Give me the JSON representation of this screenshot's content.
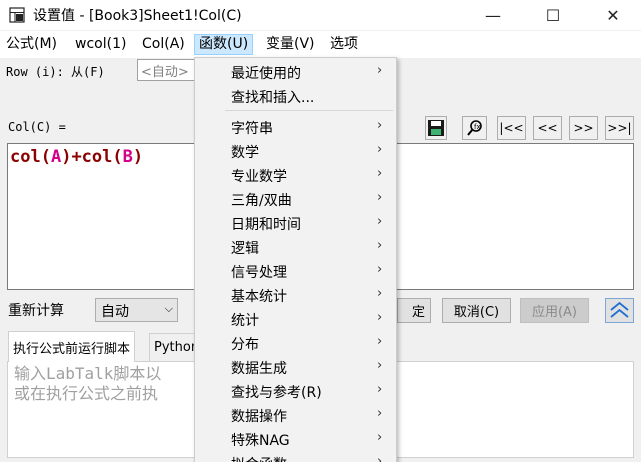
{
  "window": {
    "title": "设置值 - [Book3]Sheet1!Col(C)",
    "minimize_glyph": "—",
    "maximize_glyph": "☐",
    "close_glyph": "✕"
  },
  "menubar": {
    "items": [
      "公式(M)",
      "wcol(1)",
      "Col(A)",
      "函数(U)",
      "变量(V)",
      "选项"
    ],
    "active_index": 3
  },
  "row_range": {
    "label": "Row (i): 从(F)",
    "from_value": "<自动>"
  },
  "column": {
    "label": "Col(C) ="
  },
  "toolbar": {
    "save_icon": "save-icon",
    "find_icon": "find-icon",
    "first_label": "|<<",
    "prev_label": "<<",
    "next_label": ">>",
    "last_label": ">>|"
  },
  "formula": {
    "func1": "col(",
    "arg1": "A",
    "op": ")+col(",
    "arg2": "B",
    "close": ")"
  },
  "recalc": {
    "label": "重新计算",
    "value": "自动"
  },
  "buttons": {
    "ok_partial": "定",
    "cancel": "取消(C)",
    "apply": "应用(A)"
  },
  "tabs": {
    "before_script": "执行公式前运行脚本",
    "python_partial": "Python"
  },
  "script": {
    "placeholder_line1": "输入LabTalk脚本以",
    "placeholder_line2": "或在执行公式之前执"
  },
  "functions_menu": {
    "items": [
      {
        "label": "最近使用的",
        "submenu": true
      },
      {
        "label": "查找和插入...",
        "submenu": false
      },
      {
        "label": "字符串",
        "submenu": true
      },
      {
        "label": "数学",
        "submenu": true
      },
      {
        "label": "专业数学",
        "submenu": true
      },
      {
        "label": "三角/双曲",
        "submenu": true
      },
      {
        "label": "日期和时间",
        "submenu": true
      },
      {
        "label": "逻辑",
        "submenu": true
      },
      {
        "label": "信号处理",
        "submenu": true
      },
      {
        "label": "基本统计",
        "submenu": true
      },
      {
        "label": "统计",
        "submenu": true
      },
      {
        "label": "分布",
        "submenu": true
      },
      {
        "label": "数据生成",
        "submenu": true
      },
      {
        "label": "查找与参考(R)",
        "submenu": true
      },
      {
        "label": "数据操作",
        "submenu": true
      },
      {
        "label": "特殊NAG",
        "submenu": true
      },
      {
        "label": "拟合函数",
        "submenu": true
      }
    ],
    "arrow_glyph": "›"
  },
  "colors": {
    "menu_highlight": "#cce8ff",
    "formula_func": "#8b0000",
    "formula_arg": "#d4008a",
    "placeholder": "#a0a0a0"
  }
}
